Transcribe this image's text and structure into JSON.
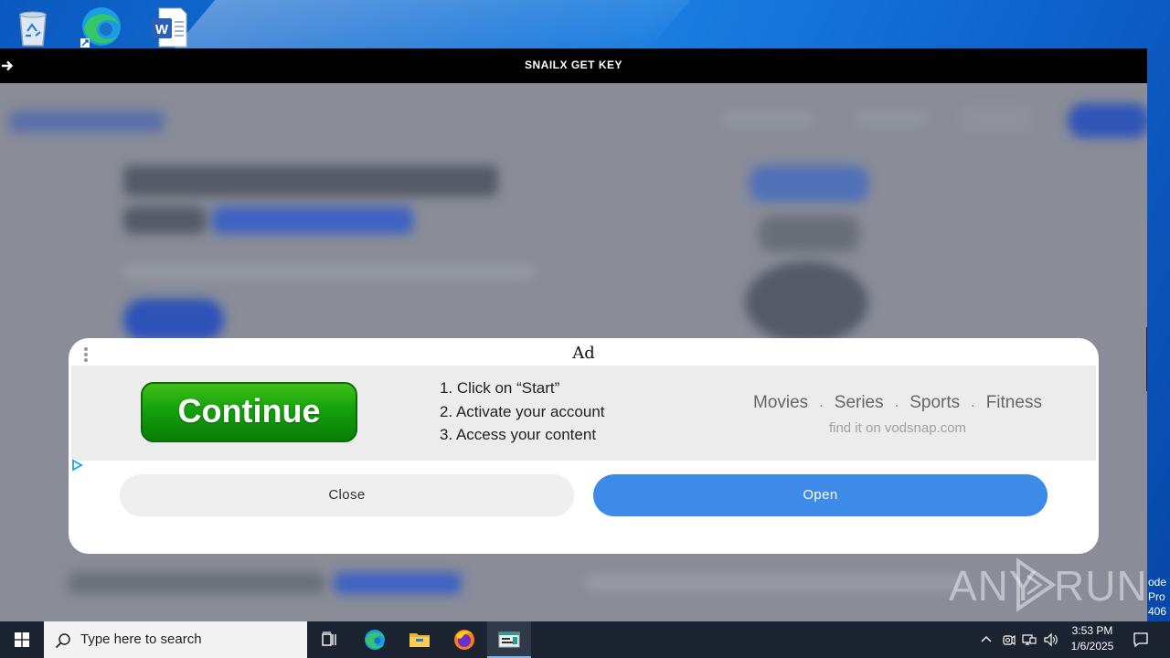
{
  "desktop": {
    "icons": [
      {
        "name": "recycle-bin-icon"
      },
      {
        "name": "edge-shortcut-icon"
      },
      {
        "name": "word-document-icon"
      }
    ]
  },
  "window": {
    "title": "SNAILX GET KEY",
    "back_icon": "arrow-right-icon"
  },
  "ad": {
    "label": "Ad",
    "continue_label": "Continue",
    "steps": [
      "1. Click on “Start”",
      "2. Activate your account",
      "3. Access your content"
    ],
    "categories": [
      "Movies",
      "Series",
      "Sports",
      "Fitness"
    ],
    "separator": ".",
    "tagline": "find it on vodsnap.com",
    "close_label": "Close",
    "open_label": "Open",
    "colors": {
      "open": "#3d8ae8",
      "continue": "#14a10b"
    }
  },
  "watermark": {
    "left": "ANY",
    "right": "RUN"
  },
  "side_text": [
    "ode",
    "Pro",
    "406"
  ],
  "taskbar": {
    "search_placeholder": "Type here to search",
    "apps": [
      "task-view-icon",
      "edge-icon",
      "file-explorer-icon",
      "firefox-icon",
      "active-app-icon"
    ],
    "clock_time": "3:53 PM",
    "clock_date": "1/6/2025"
  }
}
